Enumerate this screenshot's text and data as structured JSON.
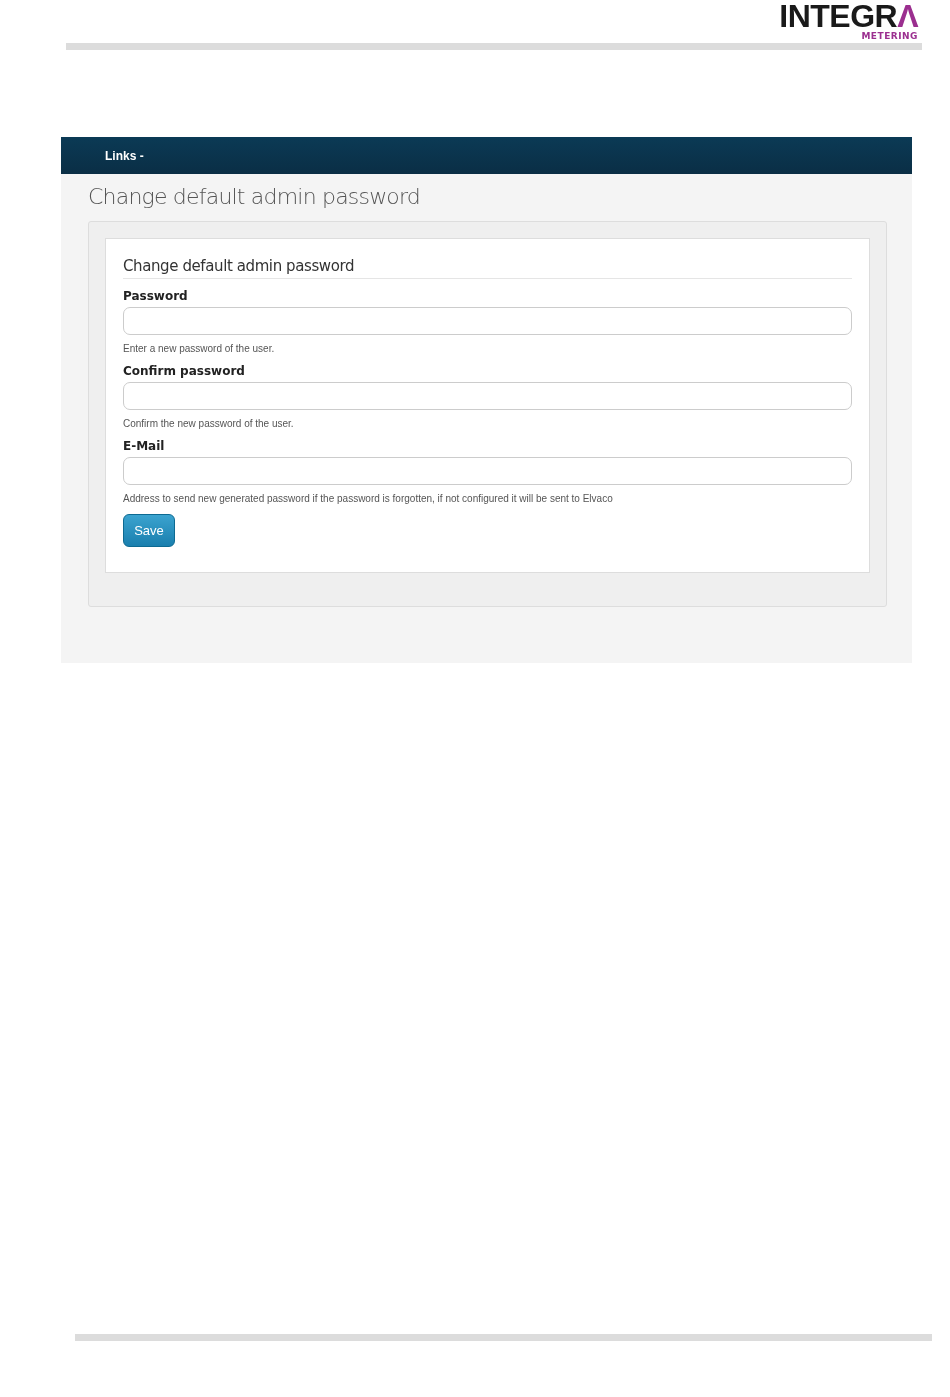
{
  "header": {
    "logo": "INTEGRΛ",
    "tagline": "METERING"
  },
  "screen": {
    "nav": {
      "menu": "Links -"
    },
    "title": "Change default admin password",
    "form": {
      "legend": "Change default admin password",
      "fields": [
        {
          "label": "Password",
          "help": "Enter a new password of the user."
        },
        {
          "label": "Confirm password",
          "help": "Confirm the new password of the user."
        },
        {
          "label": "E-Mail",
          "help": "Address to send new generated password if the password is forgotten, if not configured it will be sent to Elvaco"
        }
      ],
      "button": "Save"
    }
  }
}
